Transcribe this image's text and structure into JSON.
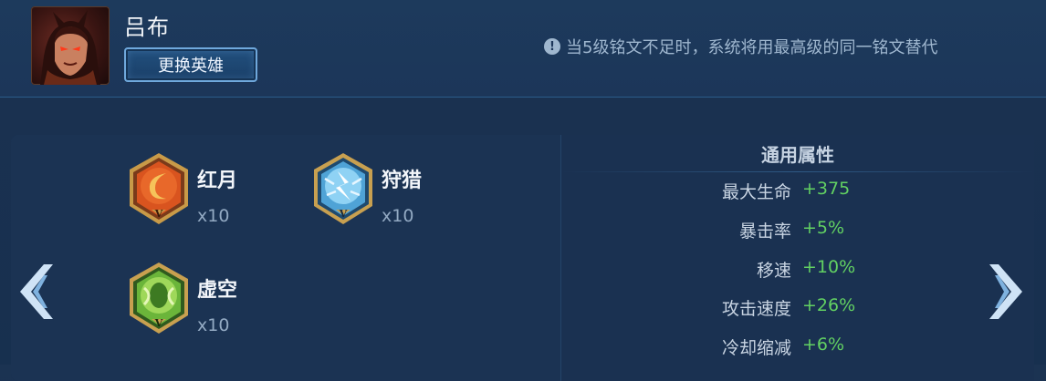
{
  "header": {
    "hero_name": "吕布",
    "change_hero_label": "更换英雄",
    "notice_icon": "!",
    "notice_text": "当5级铭文不足时，系统将用最高级的同一铭文替代"
  },
  "runes": [
    {
      "name": "红月",
      "count": "x10",
      "level": "V",
      "color": "red",
      "icon": "red-moon-rune-icon"
    },
    {
      "name": "狩猎",
      "count": "x10",
      "level": "V",
      "color": "blue",
      "icon": "hunt-rune-icon"
    },
    {
      "name": "虚空",
      "count": "x10",
      "level": "V",
      "color": "green",
      "icon": "void-rune-icon"
    }
  ],
  "attributes": {
    "title": "通用属性",
    "stats": [
      {
        "label": "最大生命",
        "value": "+375"
      },
      {
        "label": "暴击率",
        "value": "+5%"
      },
      {
        "label": "移速",
        "value": "+10%"
      },
      {
        "label": "攻击速度",
        "value": "+26%"
      },
      {
        "label": "冷却缩减",
        "value": "+6%"
      }
    ]
  },
  "colors": {
    "stat_value": "#62d162",
    "accent_border": "#6fa8dc"
  },
  "icons": {
    "left_nav": "chevron-left-icon",
    "right_nav": "chevron-right-icon",
    "portrait": "hero-portrait"
  }
}
